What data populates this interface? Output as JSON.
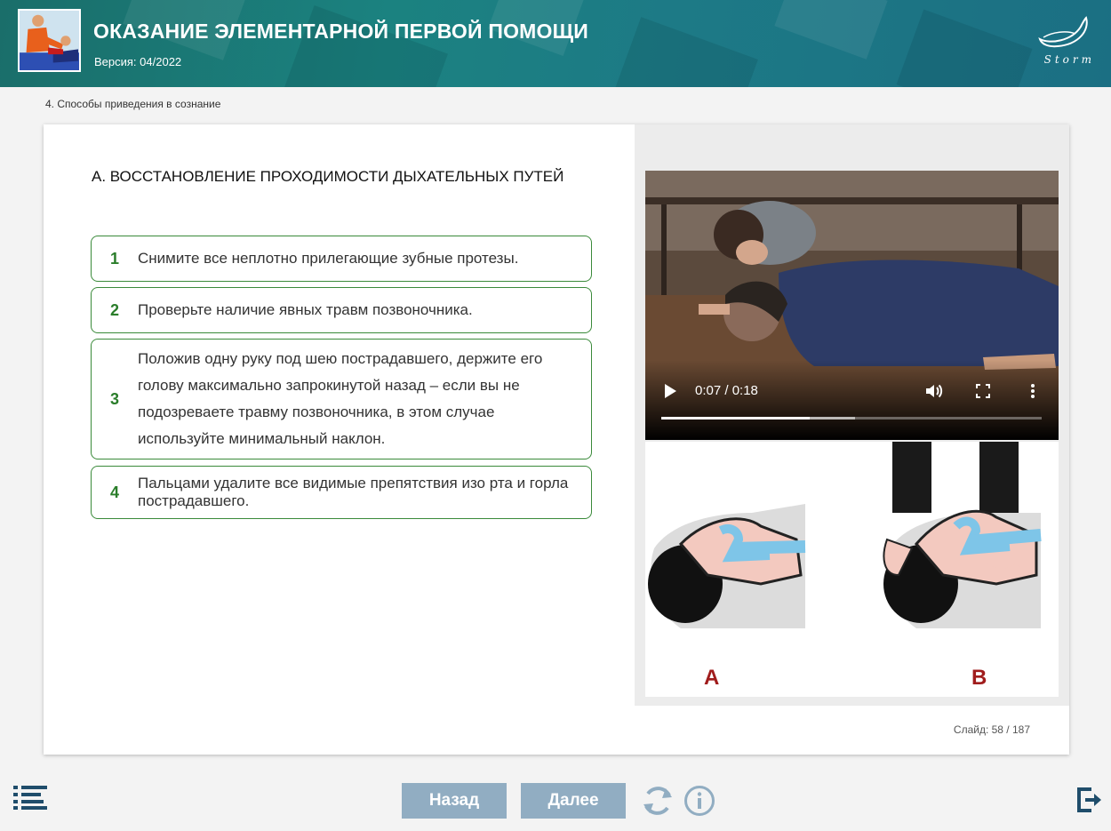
{
  "header": {
    "title": "ОКАЗАНИЕ ЭЛЕМЕНТАРНОЙ ПЕРВОЙ ПОМОЩИ",
    "version": "Версия: 04/2022",
    "brand": "Storm"
  },
  "breadcrumb": "4. Способы приведения в сознание",
  "content": {
    "section_title": "А. ВОССТАНОВЛЕНИЕ ПРОХОДИМОСТИ ДЫХАТЕЛЬНЫХ ПУТЕЙ",
    "steps": [
      {
        "number": "1",
        "text": "Снимите все неплотно прилегающие зубные протезы."
      },
      {
        "number": "2",
        "text": "Проверьте наличие явных травм позвоночника."
      },
      {
        "number": "3",
        "text": "Положив одну руку под шею пострадавшего, держите его голову максимально запрокинутой назад – если вы не подозреваете травму позвоночника, в этом случае используйте минимальный наклон."
      },
      {
        "number": "4",
        "text": "Пальцами удалите все видимые препятствия изо рта и горла пострадавшего."
      }
    ]
  },
  "video": {
    "time": "0:07 / 0:18",
    "progress_fraction": 0.39,
    "buffered_fraction": 0.51,
    "icons": [
      "play-icon",
      "volume-icon",
      "fullscreen-icon",
      "more-options-icon"
    ]
  },
  "figure": {
    "label_a": "A",
    "label_b": "B"
  },
  "slide_info": "Слайд:  58 / 187",
  "footer": {
    "back_label": "Назад",
    "next_label": "Далее",
    "icons": [
      "menu-icon",
      "replay-icon",
      "info-icon",
      "exit-icon"
    ]
  },
  "colors": {
    "header": "#1b8280",
    "step_border": "#3a8a3a",
    "step_number": "#2a7d2a",
    "nav_button": "#91adc2",
    "footer_icon": "#1f4d6b",
    "figure_label": "#a01c1c"
  }
}
